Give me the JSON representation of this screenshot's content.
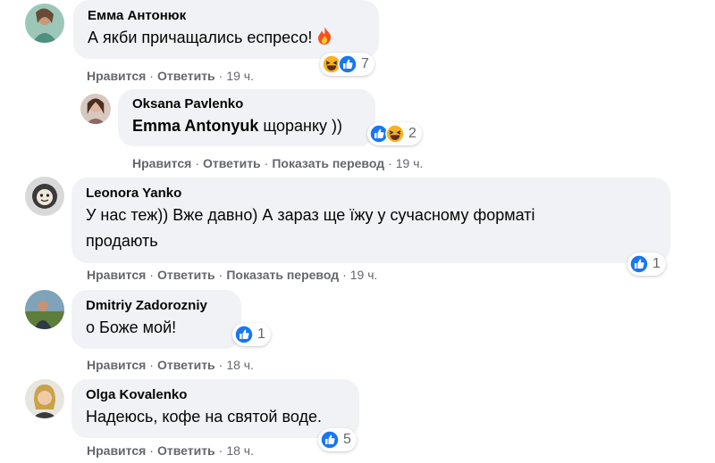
{
  "comments": [
    {
      "author": "Емма Антонюк",
      "text": "А якби причащались еспресо!",
      "emoji": "fire",
      "reactions": {
        "icons": [
          "haha-icon",
          "like-icon"
        ],
        "count": "7"
      },
      "actions": {
        "like": "Нравится",
        "reply": "Ответить",
        "time": "19 ч."
      }
    },
    {
      "author": "Oksana Pavlenko",
      "mention": "Emma Antonyuk",
      "text": " щоранку ))",
      "reactions": {
        "icons": [
          "like-icon",
          "haha-icon"
        ],
        "count": "2"
      },
      "actions": {
        "like": "Нравится",
        "reply": "Ответить",
        "translate": "Показать перевод",
        "time": "19 ч."
      }
    },
    {
      "author": "Leonora Yanko",
      "text_line1": "У нас теж)) Вже давно) А зараз ще їжу у сучасному форматі",
      "text_line2": "продають",
      "reactions": {
        "icons": [
          "like-icon"
        ],
        "count": "1"
      },
      "actions": {
        "like": "Нравится",
        "reply": "Ответить",
        "translate": "Показать перевод",
        "time": "19 ч."
      }
    },
    {
      "author": "Dmitriy Zadorozniy",
      "text": "о Боже мой!",
      "reactions": {
        "icons": [
          "like-icon"
        ],
        "count": "1"
      },
      "actions": {
        "like": "Нравится",
        "reply": "Ответить",
        "time": "18 ч."
      }
    },
    {
      "author": "Olga Kovalenko",
      "text": "Надеюсь, кофе на святой воде.",
      "reactions": {
        "icons": [
          "like-icon"
        ],
        "count": "5"
      },
      "actions": {
        "like": "Нравится",
        "reply": "Ответить",
        "time": "18 ч."
      }
    }
  ],
  "colors": {
    "bubble": "#f0f2f5",
    "meta_text": "#65676b",
    "like_blue": "#1877f2",
    "haha_yellow": "#f7b125"
  }
}
